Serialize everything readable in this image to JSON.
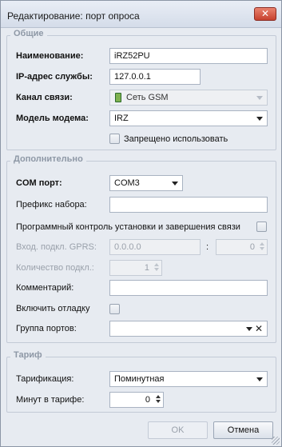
{
  "window": {
    "title": "Редактирование: порт опроса",
    "close_label": "✕"
  },
  "general": {
    "title": "Общие",
    "name_label": "Наименование:",
    "name_value": "iRZ52PU",
    "ip_label": "IP-адрес службы:",
    "ip_value": "127.0.0.1",
    "channel_label": "Канал связи:",
    "channel_value": "Сеть GSM",
    "modem_label": "Модель модема:",
    "modem_value": "IRZ",
    "forbidden_label": "Запрещено использовать",
    "forbidden_checked": false
  },
  "extra": {
    "title": "Дополнительно",
    "com_label": "COM порт:",
    "com_value": "COM3",
    "prefix_label": "Префикс набора:",
    "prefix_value": "",
    "program_control_label": "Программный контроль установки и завершения связи",
    "program_control_checked": false,
    "gprs_label": "Вход. подкл. GPRS:",
    "gprs_ip_value": "0.0.0.0",
    "gprs_sep": ":",
    "gprs_port_value": "0",
    "conn_count_label": "Количество подкл.:",
    "conn_count_value": "1",
    "comment_label": "Комментарий:",
    "comment_value": "",
    "debug_label": "Включить отладку",
    "debug_checked": false,
    "port_group_label": "Группа портов:",
    "port_group_value": "",
    "port_group_clear": "✕"
  },
  "tariff": {
    "title": "Тариф",
    "tariffing_label": "Тарификация:",
    "tariffing_value": "Поминутная",
    "minutes_label": "Минут в тарифе:",
    "minutes_value": "0"
  },
  "buttons": {
    "ok_label": "OK",
    "cancel_label": "Отмена"
  }
}
